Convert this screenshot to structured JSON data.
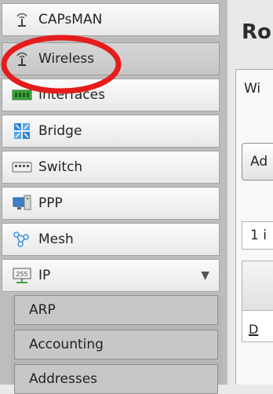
{
  "sidebar": {
    "items": [
      {
        "label": "CAPsMAN",
        "icon": "antenna-icon"
      },
      {
        "label": "Wireless",
        "icon": "antenna-icon",
        "active": true
      },
      {
        "label": "Interfaces",
        "icon": "interfaces-icon"
      },
      {
        "label": "Bridge",
        "icon": "bridge-icon"
      },
      {
        "label": "Switch",
        "icon": "switch-icon"
      },
      {
        "label": "PPP",
        "icon": "ppp-icon"
      },
      {
        "label": "Mesh",
        "icon": "mesh-icon"
      },
      {
        "label": "IP",
        "icon": "ip-icon",
        "expanded": true
      }
    ],
    "ip_submenu": [
      "ARP",
      "Accounting",
      "Addresses"
    ]
  },
  "main": {
    "title": "Ro",
    "tab_label": "Wi",
    "add_button_label": "Ad",
    "items_count": "1 i",
    "row_flag": "D"
  },
  "colors": {
    "highlight_ring": "#e51c1c",
    "sidebar_bg": "#bdbdbd",
    "accent_blue": "#2f86d6",
    "accent_green": "#3ca63c"
  }
}
